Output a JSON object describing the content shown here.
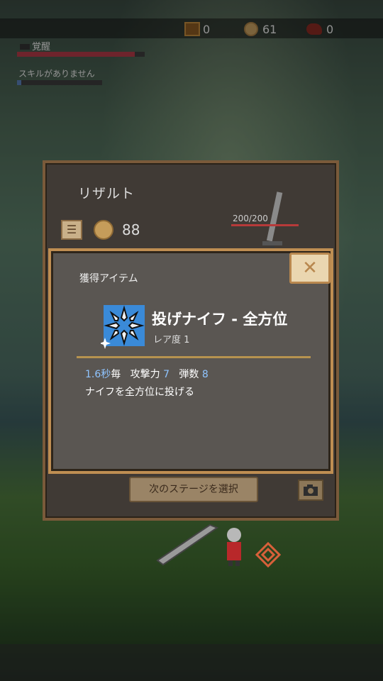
{
  "topbar": {
    "chest_count": "0",
    "coin_count": "61",
    "meat_count": "0"
  },
  "status": {
    "awaken_label": "覚醒",
    "awaken_fill": 0.92,
    "skills_label": "スキルがありません",
    "skills_fill": 0.05
  },
  "result": {
    "title": "リザルト",
    "menu_icon": "menu-icon",
    "gold": "88",
    "hp": "200/200"
  },
  "item_panel": {
    "heading": "獲得アイテム",
    "name": "投げナイフ - 全方位",
    "rarity": "レア度 1",
    "stats": {
      "interval_value": "1.6秒",
      "interval_suffix": "毎",
      "attack_label": "攻撃力",
      "attack_value": "7",
      "bullets_label": "弾数",
      "bullets_value": "8"
    },
    "description": "ナイフを全方位に投げる",
    "close_symbol": "✕"
  },
  "buttons": {
    "next_stage": "次のステージを選択",
    "camera_icon": "camera-icon"
  },
  "colors": {
    "accent_gold": "#bf8e52",
    "stat_blue": "#8fc4ff",
    "hp_red": "#b73a3a"
  }
}
